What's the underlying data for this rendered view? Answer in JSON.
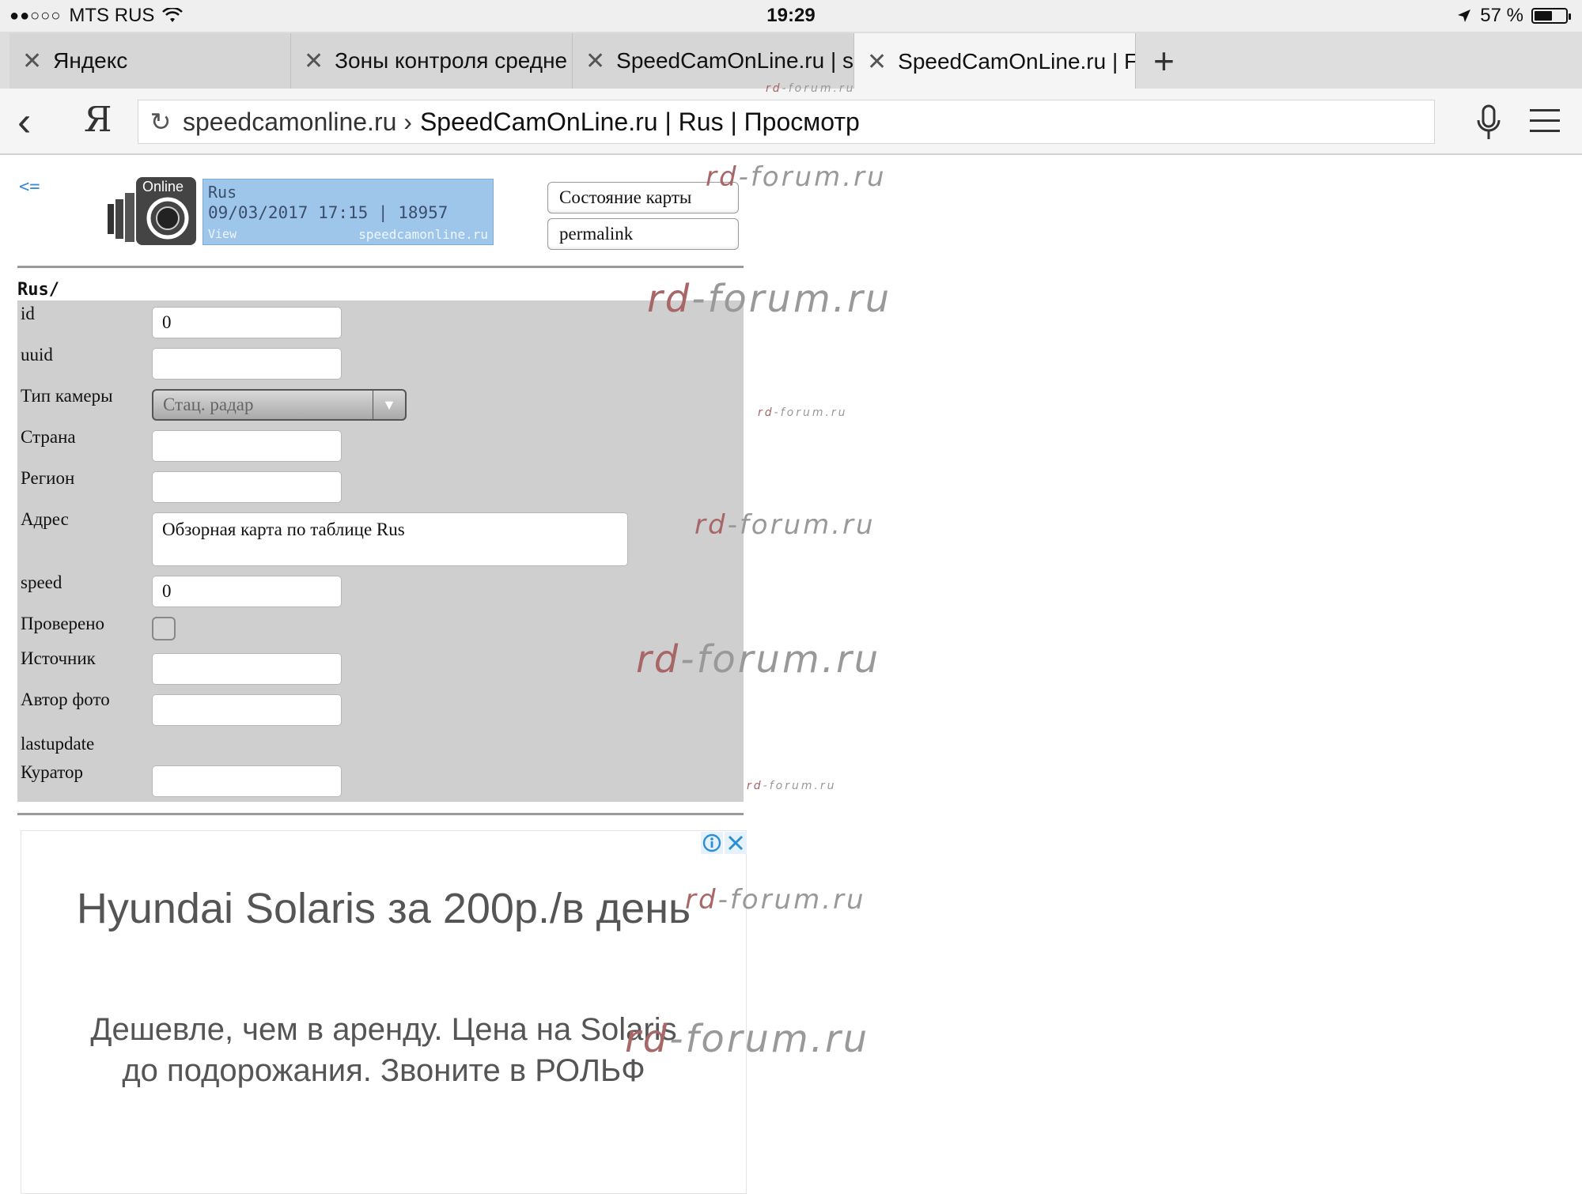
{
  "status_bar": {
    "carrier": "MTS RUS",
    "time": "19:29",
    "battery": "57 %",
    "battery_level": 0.57
  },
  "tabs": [
    {
      "label": "Яндекс",
      "active": false
    },
    {
      "label": "Зоны контроля средне",
      "active": false
    },
    {
      "label": "SpeedCamOnLine.ru | s",
      "active": false
    },
    {
      "label": "SpeedCamOnLine.ru | F",
      "active": true
    }
  ],
  "address_bar": {
    "domain": "speedcamonline.ru ›",
    "title": "SpeedCamOnLine.ru | Rus | Просмотр",
    "yandex_button": "Я"
  },
  "page": {
    "back_link": "<=",
    "logo": {
      "badge": "Online",
      "line1": "Rus",
      "line2": "09/03/2017 17:15 | 18957",
      "line3": "View",
      "line4": "speedcamonline.ru"
    },
    "map_state_button": "Состояние карты",
    "permalink_button": "permalink",
    "section_title": "Rus/",
    "form": {
      "id_label": "id",
      "id_value": "0",
      "uuid_label": "uuid",
      "uuid_value": "",
      "camera_type_label": "Тип камеры",
      "camera_type_value": "Стац. радар",
      "country_label": "Страна",
      "country_value": "",
      "region_label": "Регион",
      "region_value": "",
      "address_label": "Адрес",
      "address_value": "Обзорная карта по таблице Rus",
      "speed_label": "speed",
      "speed_value": "0",
      "checked_label": "Проверено",
      "checked_value": false,
      "source_label": "Источник",
      "source_value": "",
      "photo_author_label": "Автор фото",
      "photo_author_value": "",
      "lastupdate_label": "lastupdate",
      "curator_label": "Куратор",
      "curator_value": ""
    }
  },
  "ad": {
    "headline": "Hyundai Solaris за 200р./в день",
    "body_line1": "Дешевле, чем в аренду. Цена на Solaris",
    "body_line2": "до подорожания. Звоните в РОЛЬФ",
    "info_icon": "info-icon",
    "close_icon": "close-icon"
  },
  "watermark": {
    "prefix": "rd",
    "suffix": "-forum.ru"
  },
  "colors": {
    "link": "#3a8bd8",
    "form_bg": "#cfcfcf",
    "ad_icon": "#2a8fd4"
  }
}
